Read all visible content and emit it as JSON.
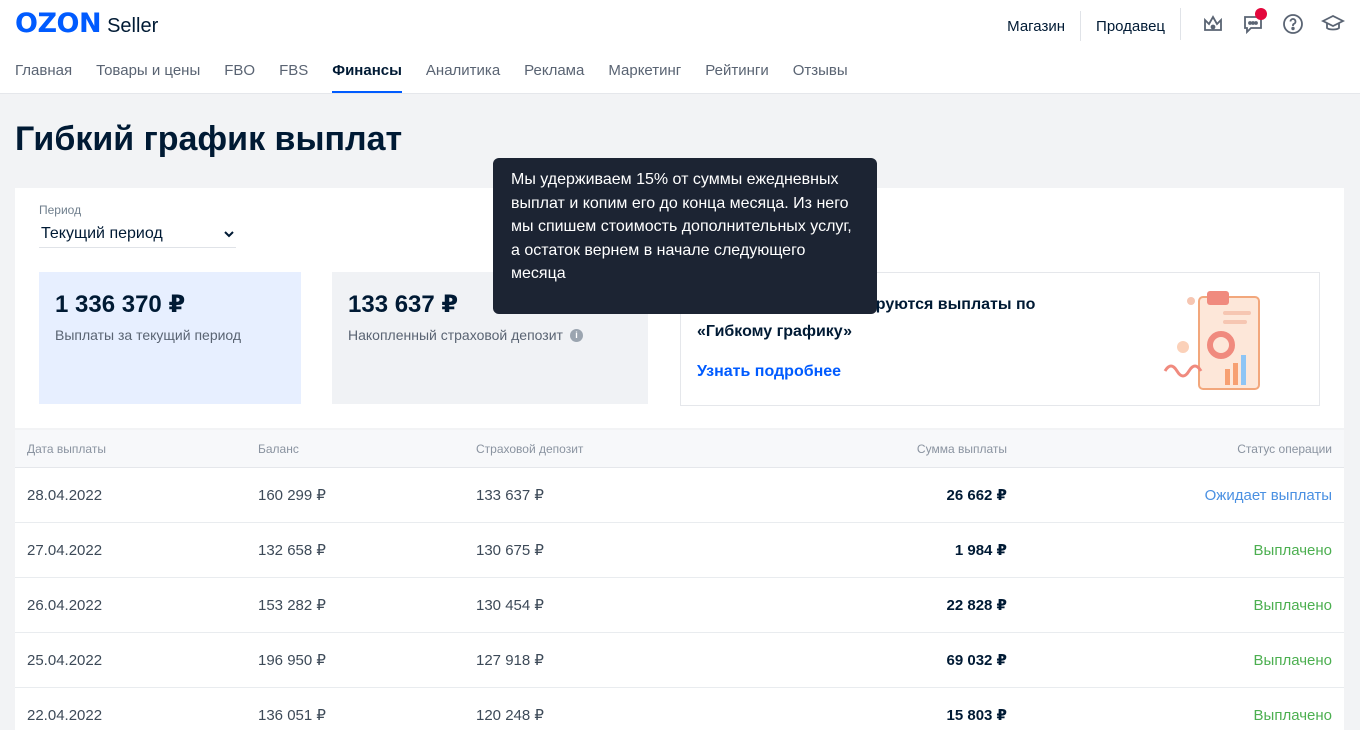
{
  "logo": {
    "brand": "OZON",
    "product": "Seller"
  },
  "top_links": [
    "Магазин",
    "Продавец"
  ],
  "icons": [
    "crown-icon",
    "chat-icon",
    "help-icon",
    "graduation-cap-icon"
  ],
  "nav": [
    "Главная",
    "Товары и цены",
    "FBO",
    "FBS",
    "Финансы",
    "Аналитика",
    "Реклама",
    "Маркетинг",
    "Рейтинги",
    "Отзывы"
  ],
  "page_title": "Гибкий график выплат",
  "period": {
    "label": "Период",
    "value": "Текущий период"
  },
  "stats": [
    {
      "value": "1 336 370 ₽",
      "label": "Выплаты за текущий период"
    },
    {
      "value": "133 637 ₽",
      "label": "Накопленный страховой депозит"
    }
  ],
  "promo": {
    "text": "Расскажем, как формируются выплаты по «Гибкому графику»",
    "link": "Узнать подробнее"
  },
  "tooltip": "Мы удерживаем 15% от суммы ежедневных выплат и копим его до конца месяца. Из него мы спишем стоимость дополнительных услуг, а остаток вернем в начале следующего месяца",
  "table": {
    "headers": [
      "Дата выплаты",
      "Баланс",
      "Страховой депозит",
      "Сумма выплаты",
      "Статус операции"
    ],
    "rows": [
      {
        "date": "28.04.2022",
        "balance": "160 299 ₽",
        "deposit": "133 637 ₽",
        "sum": "26 662 ₽",
        "status": "Ожидает выплаты"
      },
      {
        "date": "27.04.2022",
        "balance": "132 658 ₽",
        "deposit": "130 675 ₽",
        "sum": "1 984 ₽",
        "status": "Выплачено"
      },
      {
        "date": "26.04.2022",
        "balance": "153 282 ₽",
        "deposit": "130 454 ₽",
        "sum": "22 828 ₽",
        "status": "Выплачено"
      },
      {
        "date": "25.04.2022",
        "balance": "196 950 ₽",
        "deposit": "127 918 ₽",
        "sum": "69 032 ₽",
        "status": "Выплачено"
      },
      {
        "date": "22.04.2022",
        "balance": "136 051 ₽",
        "deposit": "120 248 ₽",
        "sum": "15 803 ₽",
        "status": "Выплачено"
      }
    ]
  },
  "colors": {
    "accent": "#005bff",
    "paid": "#4caf50",
    "waiting": "#4a90e2",
    "notification": "#e3073c"
  }
}
